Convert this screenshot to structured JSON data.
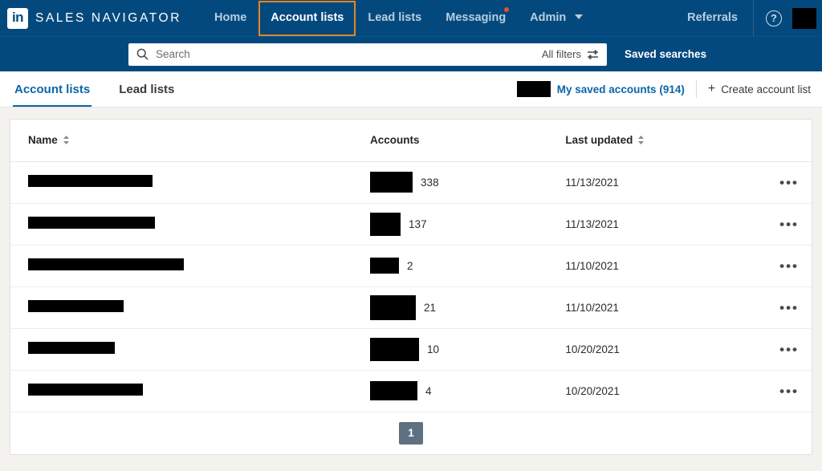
{
  "brand": {
    "logo_icon": "linkedin-logo-icon",
    "logo_text": "in",
    "product_name": "SALES NAVIGATOR"
  },
  "topnav": {
    "items": [
      {
        "label": "Home",
        "active": false,
        "has_badge": false,
        "has_caret": false
      },
      {
        "label": "Account lists",
        "active": true,
        "has_badge": false,
        "has_caret": false
      },
      {
        "label": "Lead lists",
        "active": false,
        "has_badge": false,
        "has_caret": false
      },
      {
        "label": "Messaging",
        "active": false,
        "has_badge": true,
        "has_caret": false
      },
      {
        "label": "Admin",
        "active": false,
        "has_badge": false,
        "has_caret": true
      }
    ],
    "referrals_label": "Referrals",
    "help_icon": "question-mark-circle-icon",
    "help_glyph": "?",
    "avatar": "redacted-avatar",
    "active_outline_color": "#e68523",
    "background_color": "#04497e",
    "badge_color": "#e8493a"
  },
  "search": {
    "icon": "search-icon",
    "placeholder": "Search",
    "value": "",
    "all_filters_label": "All filters",
    "all_filters_icon": "sliders-icon",
    "saved_searches_label": "Saved searches"
  },
  "subnav": {
    "tabs": [
      {
        "label": "Account lists",
        "active": true
      },
      {
        "label": "Lead lists",
        "active": false
      }
    ],
    "saved_accounts_label": "My saved accounts (914)",
    "saved_accounts_redacted_thumb": "redacted-thumbnail",
    "create_list_label": "Create account list",
    "create_list_icon": "plus-icon",
    "accent_color": "#0a66a8"
  },
  "table": {
    "columns": [
      {
        "label": "Name",
        "sortable": true,
        "sort_icon": "sort-chevrons-icon"
      },
      {
        "label": "Accounts",
        "sortable": false,
        "sort_icon": ""
      },
      {
        "label": "Last updated",
        "sortable": true,
        "sort_icon": "sort-chevrons-icon"
      },
      {
        "label": "",
        "sortable": false,
        "sort_icon": ""
      }
    ],
    "rows": [
      {
        "name": "",
        "name_redacted_width": 155,
        "accounts_redacted_width": 53,
        "accounts_redacted_height": 26,
        "accounts": "338",
        "last_updated": "11/13/2021",
        "actions_icon": "overflow-menu-icon",
        "actions_glyph": "•••"
      },
      {
        "name": "",
        "name_redacted_width": 158,
        "accounts_redacted_width": 38,
        "accounts_redacted_height": 29,
        "accounts": "137",
        "last_updated": "11/13/2021",
        "actions_icon": "overflow-menu-icon",
        "actions_glyph": "•••"
      },
      {
        "name": "",
        "name_redacted_width": 194,
        "accounts_redacted_width": 36,
        "accounts_redacted_height": 20,
        "accounts": "2",
        "last_updated": "11/10/2021",
        "actions_icon": "overflow-menu-icon",
        "actions_glyph": "•••"
      },
      {
        "name": "",
        "name_redacted_width": 119,
        "accounts_redacted_width": 57,
        "accounts_redacted_height": 31,
        "accounts": "21",
        "last_updated": "11/10/2021",
        "actions_icon": "overflow-menu-icon",
        "actions_glyph": "•••"
      },
      {
        "name": "",
        "name_redacted_width": 108,
        "accounts_redacted_width": 61,
        "accounts_redacted_height": 29,
        "accounts": "10",
        "last_updated": "10/20/2021",
        "actions_icon": "overflow-menu-icon",
        "actions_glyph": "•••"
      },
      {
        "name": "",
        "name_redacted_width": 143,
        "accounts_redacted_width": 59,
        "accounts_redacted_height": 24,
        "accounts": "4",
        "last_updated": "10/20/2021",
        "actions_icon": "overflow-menu-icon",
        "actions_glyph": "•••"
      }
    ]
  },
  "pagination": {
    "current_page": "1",
    "pages": [
      "1"
    ],
    "active_color": "#5e7181"
  }
}
